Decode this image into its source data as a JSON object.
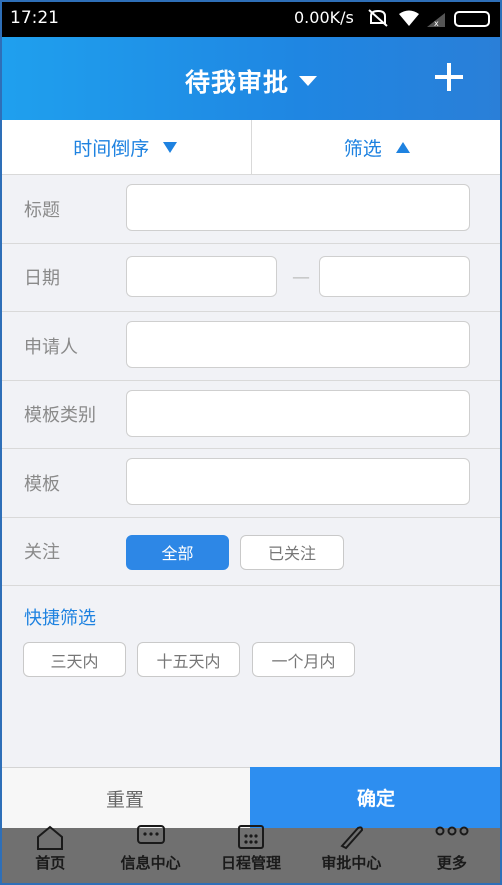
{
  "status_bar": {
    "time": "17:21",
    "speed": "0.00K/s",
    "icons": [
      "mute-icon",
      "wifi-icon",
      "signal-icon",
      "battery-icon"
    ]
  },
  "header": {
    "title": "待我审批",
    "add_icon": "plus-icon"
  },
  "tabs": {
    "sort_label": "时间倒序",
    "filter_label": "筛选"
  },
  "form": {
    "title_label": "标题",
    "title_value": "",
    "date_label": "日期",
    "date_from": "",
    "date_separator": "—",
    "date_to": "",
    "applicant_label": "申请人",
    "applicant_value": "",
    "category_label": "模板类别",
    "category_value": "",
    "template_label": "模板",
    "template_value": "",
    "follow_label": "关注",
    "follow_options": [
      "全部",
      "已关注"
    ],
    "follow_selected": "全部"
  },
  "quick_filter": {
    "title": "快捷筛选",
    "options": [
      "三天内",
      "十五天内",
      "一个月内"
    ]
  },
  "actions": {
    "reset": "重置",
    "confirm": "确定"
  },
  "bottom_nav": {
    "items": [
      {
        "label": "首页",
        "icon": "home-icon"
      },
      {
        "label": "信息中心",
        "icon": "chat-icon"
      },
      {
        "label": "日程管理",
        "icon": "calendar-icon"
      },
      {
        "label": "审批中心",
        "icon": "pen-icon"
      },
      {
        "label": "更多",
        "icon": "more-icon"
      }
    ]
  },
  "colors": {
    "accent": "#1e82e0",
    "header_bg": "#1f8fe8",
    "confirm_bg": "#2d8ef0",
    "overlay_nav": "#707070"
  }
}
